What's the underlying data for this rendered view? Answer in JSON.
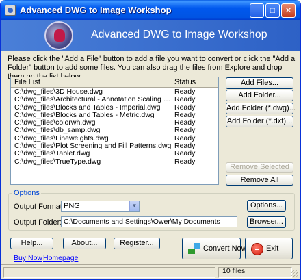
{
  "window": {
    "title": "Advanced DWG to Image Workshop",
    "controls": {
      "minimize": "_",
      "maximize": "□",
      "close": "✕"
    }
  },
  "banner": {
    "title": "Advanced DWG to Image Workshop",
    "logo": "ink-bottle-icon"
  },
  "instructions": "Please click the \"Add a File\" button to add a file you want to convert or click the \"Add a Folder\" button to add some files. You can also drag the files from Explore and drop them on the list below.",
  "file_list": {
    "columns": [
      "File List",
      "Status"
    ],
    "rows": [
      {
        "file": "C:\\dwg_files\\3D House.dwg",
        "status": "Ready"
      },
      {
        "file": "C:\\dwg_files\\Architectural - Annotation Scaling and Multi...",
        "status": "Ready"
      },
      {
        "file": "C:\\dwg_files\\Blocks and Tables - Imperial.dwg",
        "status": "Ready"
      },
      {
        "file": "C:\\dwg_files\\Blocks and Tables - Metric.dwg",
        "status": "Ready"
      },
      {
        "file": "C:\\dwg_files\\colorwh.dwg",
        "status": "Ready"
      },
      {
        "file": "C:\\dwg_files\\db_samp.dwg",
        "status": "Ready"
      },
      {
        "file": "C:\\dwg_files\\Lineweights.dwg",
        "status": "Ready"
      },
      {
        "file": "C:\\dwg_files\\Plot Screening and Fill Patterns.dwg",
        "status": "Ready"
      },
      {
        "file": "C:\\dwg_files\\Tablet.dwg",
        "status": "Ready"
      },
      {
        "file": "C:\\dwg_files\\TrueType.dwg",
        "status": "Ready"
      }
    ]
  },
  "side_buttons": {
    "add_files": "Add Files...",
    "add_folder": "Add Folder...",
    "add_folder_dwg": "Add Folder (*.dwg)...",
    "add_folder_dxf": "Add Folder (*.dxf)...",
    "remove_selected": "Remove Selected",
    "remove_all": "Remove All"
  },
  "options": {
    "group_label": "Options",
    "output_format_label": "Output Format:",
    "output_format_value": "PNG",
    "options_button": "Options...",
    "output_folder_label": "Output Folder:",
    "output_folder_value": "C:\\Documents and Settings\\Ower\\My Documents",
    "browse_button": "Browser..."
  },
  "bottom_buttons": {
    "help": "Help...",
    "about": "About...",
    "register": "Register...",
    "convert": "Convert Now",
    "exit": "Exit"
  },
  "links": {
    "buy_now": "Buy Now",
    "homepage": "Homepage"
  },
  "status_bar": {
    "file_count": "10 files"
  }
}
